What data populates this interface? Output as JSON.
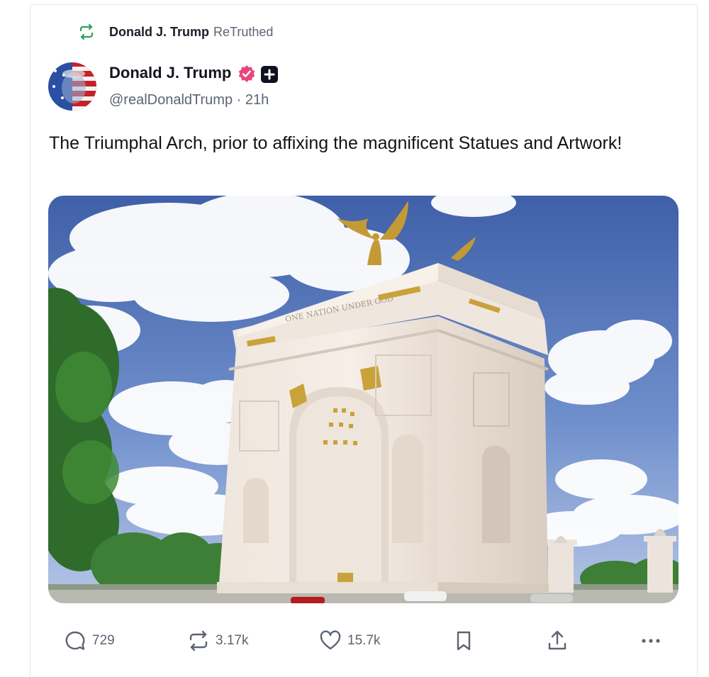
{
  "retruth": {
    "author": "Donald J. Trump",
    "label": "ReTruthed",
    "icon": "retruth-icon"
  },
  "post": {
    "author_name": "Donald J. Trump",
    "handle": "@realDonaldTrump",
    "separator": "·",
    "time": "21h",
    "text": "The Triumphal Arch, prior to affixing the magnificent Statues and Artwork!",
    "media_arch_inscription": "ONE NATION UNDER GOD",
    "badges": [
      "verified-badge-icon",
      "truth-plus-badge-icon"
    ]
  },
  "actions": {
    "replies": "729",
    "retruths": "3.17k",
    "likes": "15.7k"
  },
  "colors": {
    "accent_green": "#27a25a",
    "verified_pink": "#e8467c",
    "muted_text": "#5b6472"
  }
}
